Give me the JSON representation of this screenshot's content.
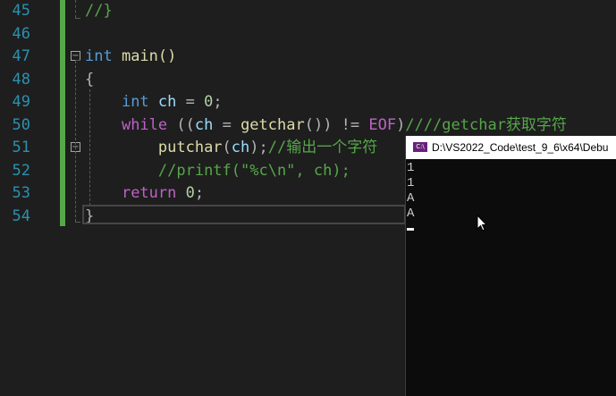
{
  "editor": {
    "lines": [
      {
        "num": "45",
        "tokens": [
          {
            "t": "//}",
            "c": "cmt"
          }
        ]
      },
      {
        "num": "46",
        "tokens": []
      },
      {
        "num": "47",
        "tokens": [
          {
            "t": "int",
            "c": "kw"
          },
          {
            "t": " main()",
            "c": "fn"
          }
        ]
      },
      {
        "num": "48",
        "tokens": [
          {
            "t": "{",
            "c": "op"
          }
        ]
      },
      {
        "num": "49",
        "tokens": [
          {
            "t": "    ",
            "c": ""
          },
          {
            "t": "int",
            "c": "kw"
          },
          {
            "t": " ",
            "c": ""
          },
          {
            "t": "ch",
            "c": "var"
          },
          {
            "t": " = ",
            "c": "op"
          },
          {
            "t": "0",
            "c": "num"
          },
          {
            "t": ";",
            "c": "op"
          }
        ]
      },
      {
        "num": "50",
        "tokens": [
          {
            "t": "    ",
            "c": ""
          },
          {
            "t": "while",
            "c": "mac"
          },
          {
            "t": " ((",
            "c": "op"
          },
          {
            "t": "ch",
            "c": "var"
          },
          {
            "t": " = ",
            "c": "op"
          },
          {
            "t": "getchar",
            "c": "fn"
          },
          {
            "t": "()) != ",
            "c": "op"
          },
          {
            "t": "EOF",
            "c": "mac"
          },
          {
            "t": ")",
            "c": "op"
          },
          {
            "t": "////getchar获取字符",
            "c": "cmt"
          }
        ]
      },
      {
        "num": "51",
        "tokens": [
          {
            "t": "        ",
            "c": ""
          },
          {
            "t": "putchar",
            "c": "fn"
          },
          {
            "t": "(",
            "c": "op"
          },
          {
            "t": "ch",
            "c": "var"
          },
          {
            "t": ");",
            "c": "op"
          },
          {
            "t": "//输出一个字符",
            "c": "cmt"
          }
        ]
      },
      {
        "num": "52",
        "tokens": [
          {
            "t": "        ",
            "c": ""
          },
          {
            "t": "//printf(\"%c\\n\", ch);",
            "c": "cmt"
          }
        ]
      },
      {
        "num": "53",
        "tokens": [
          {
            "t": "    ",
            "c": ""
          },
          {
            "t": "return",
            "c": "mac"
          },
          {
            "t": " ",
            "c": ""
          },
          {
            "t": "0",
            "c": "num"
          },
          {
            "t": ";",
            "c": "op"
          }
        ]
      },
      {
        "num": "54",
        "tokens": [
          {
            "t": "}",
            "c": "op"
          }
        ]
      }
    ]
  },
  "console": {
    "title": "D:\\VS2022_Code\\test_9_6\\x64\\Debu",
    "icon": "console-app-icon",
    "icon_text": "C:\\",
    "output": [
      "1",
      "1",
      "A",
      "A"
    ]
  },
  "colors": {
    "keyword": "#569cd6",
    "function": "#dcdcaa",
    "variable": "#9cdcfe",
    "number": "#b5cea8",
    "comment": "#57a64a",
    "control": "#bd63c5",
    "line_number": "#2b91af",
    "background": "#1e1e1e"
  }
}
